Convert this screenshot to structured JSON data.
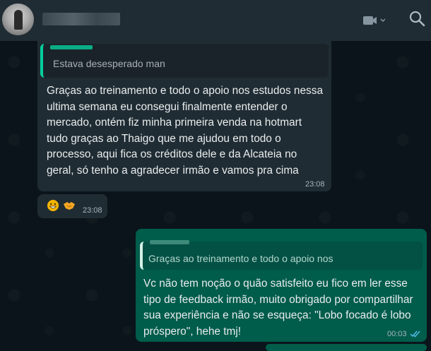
{
  "header": {
    "contact_name": "•••••••••••",
    "icons": [
      "avatar",
      "video-call-icon",
      "chevron-down-icon",
      "search-icon"
    ]
  },
  "messages": [
    {
      "direction": "incoming",
      "quoted_text": "Estava desesperado man",
      "lines": [
        "Graças ao treinamento e todo o apoio nos estudos nessa",
        "ultima semana eu consegui finalmente entender o",
        "mercado, ontém fiz minha primeira venda na hotmart",
        "tudo graças ao Thaigo que me ajudou em todo o",
        "processo, aqui fica os créditos dele e da Alcateia no",
        "geral, só tenho a agradecer irmão e vamos pra cima"
      ],
      "time": "23:08"
    },
    {
      "direction": "incoming",
      "emojis": [
        "grinning-face",
        "handshake"
      ],
      "time": "23:08"
    },
    {
      "direction": "outgoing",
      "quoted_text": "Graças ao treinamento e todo o apoio nos",
      "lines": [
        "Vc não tem noção o quão satisfeito eu fico em ler esse",
        "tipo de feedback irmão, muito obrigado por compartilhar",
        "sua experiência e não se esqueça: \"Lobo focado é lobo",
        "próspero\", hehe tmj!"
      ],
      "time": "00:03",
      "status": "read"
    }
  ],
  "colors": {
    "header_bg": "#202c33",
    "chat_bg": "#0b141a",
    "incoming_bubble": "#202c33",
    "outgoing_bubble": "#005c4b",
    "accent": "#06cf9c",
    "read_ticks": "#53bdeb"
  }
}
